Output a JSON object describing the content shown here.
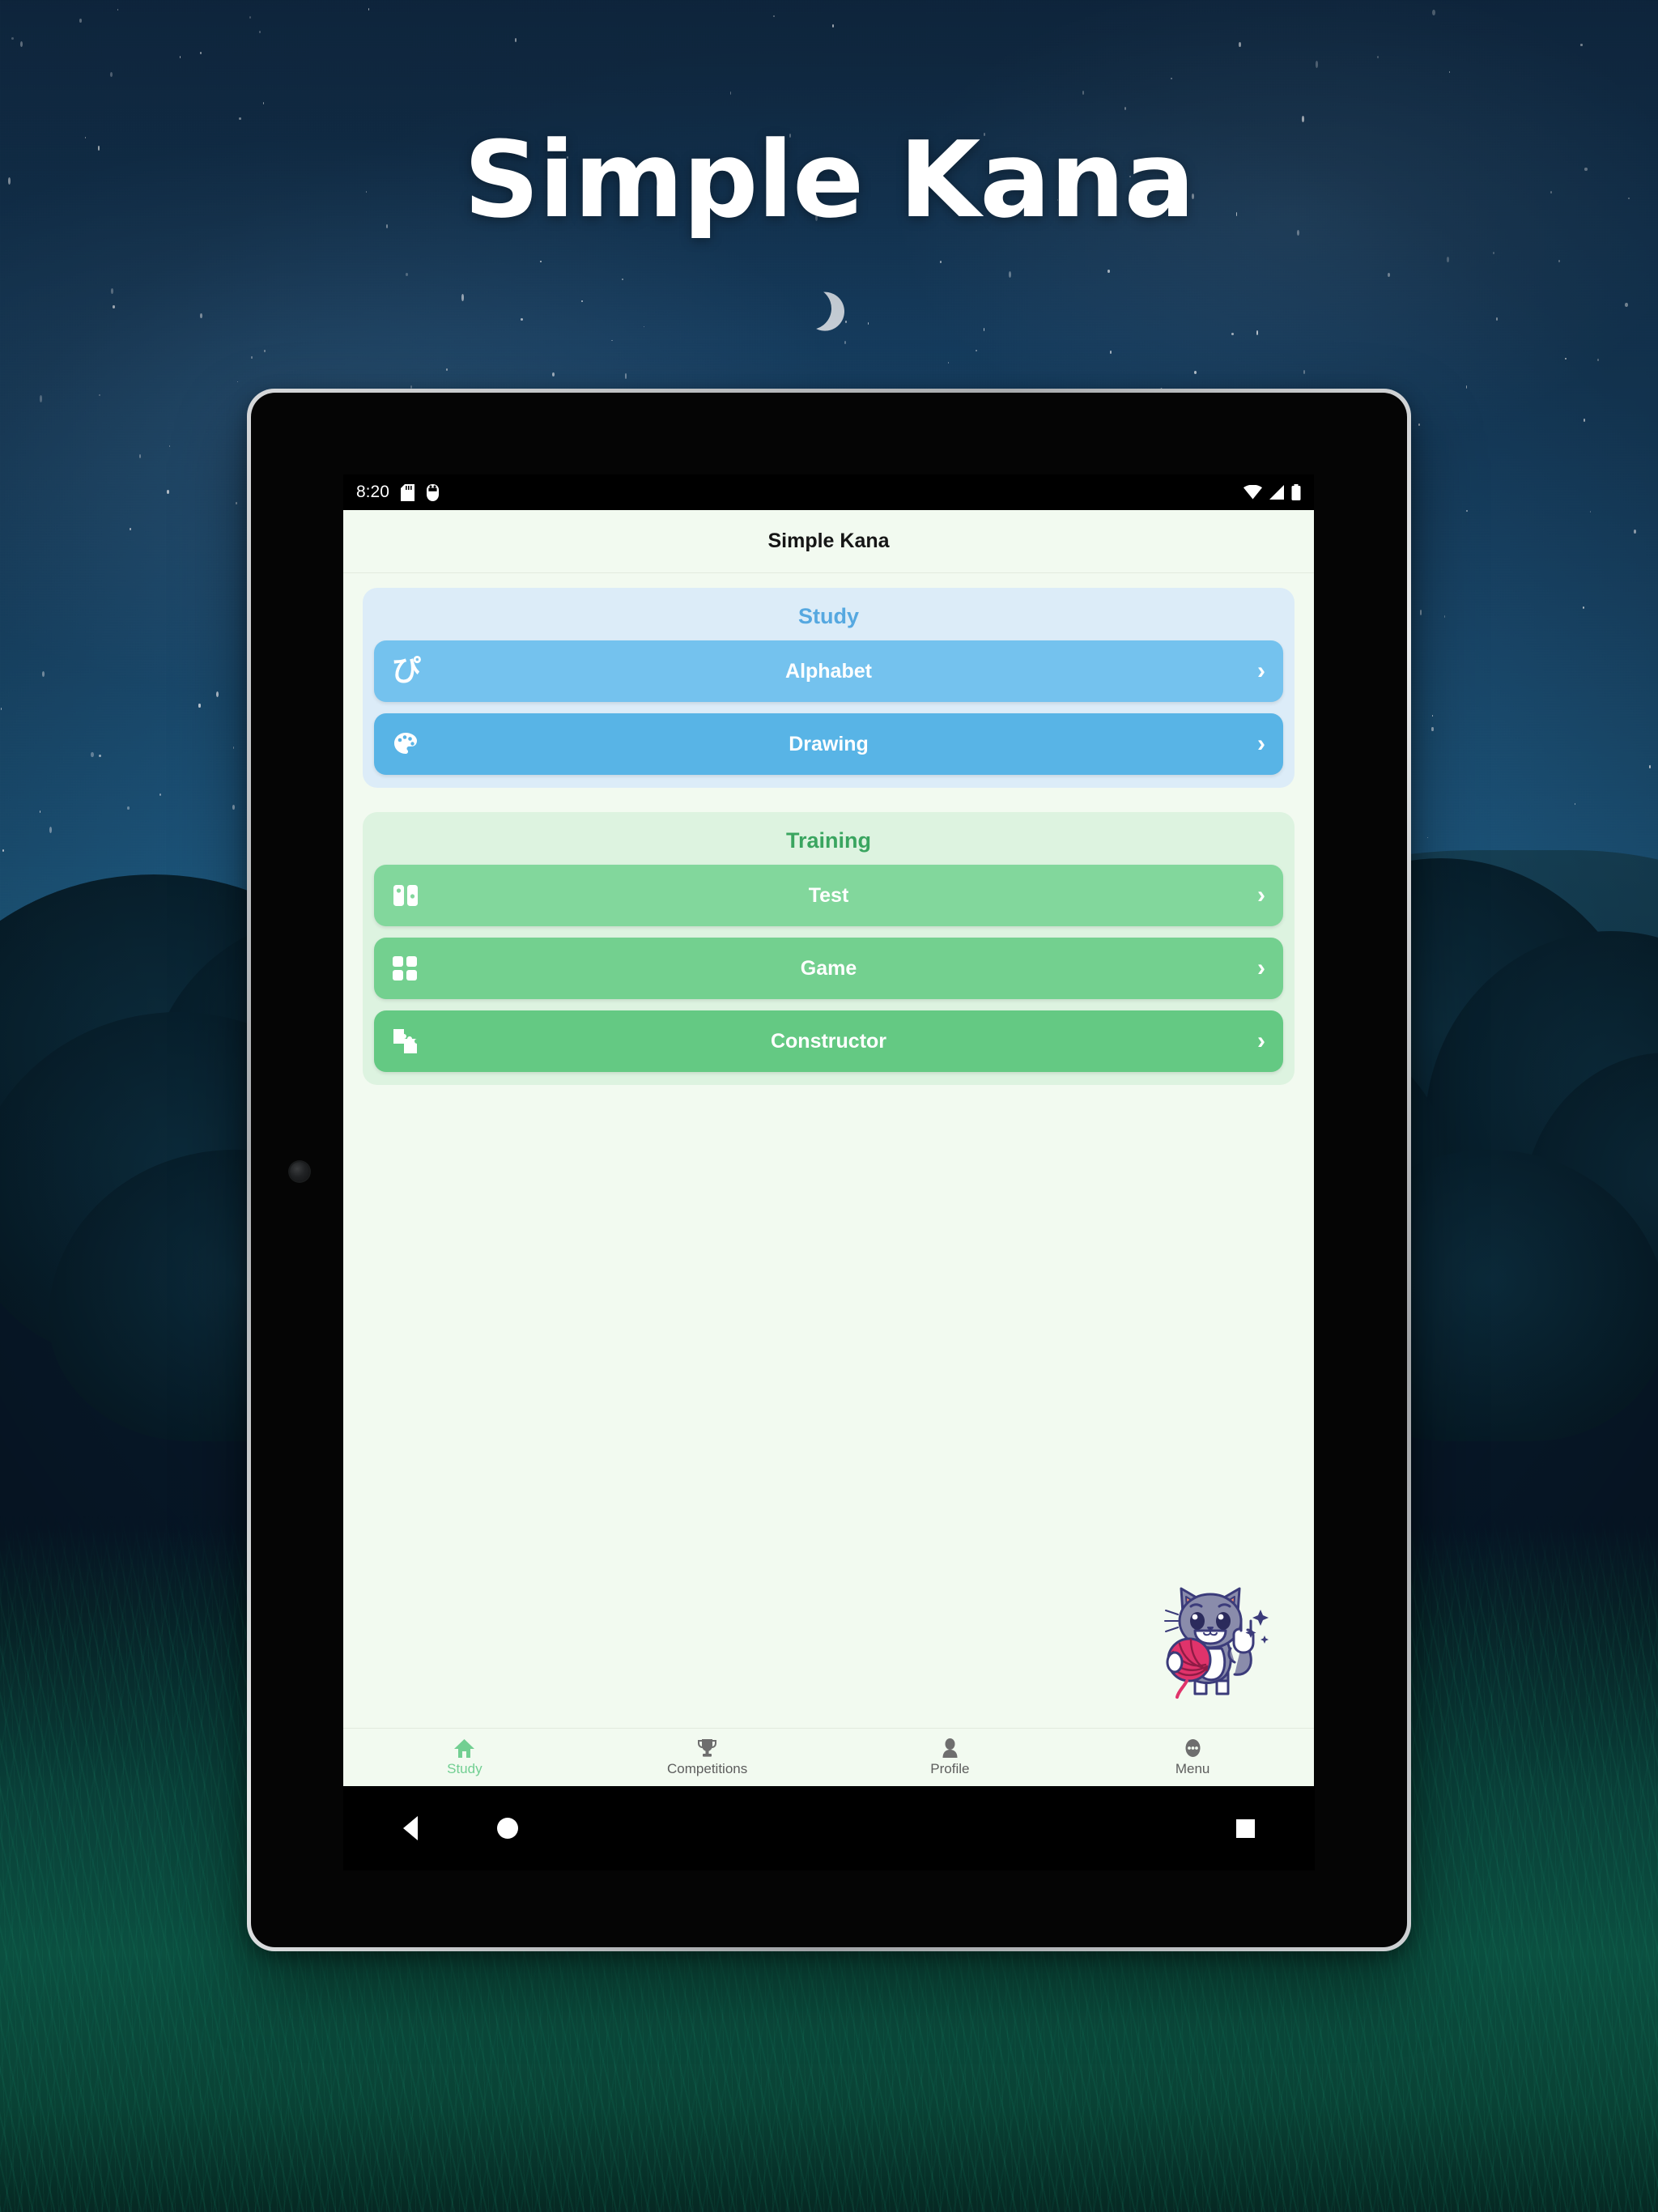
{
  "hero": {
    "title": "Simple Kana"
  },
  "device": {
    "status_bar": {
      "time": "8:20",
      "left_icons": [
        "sd-card-icon",
        "usb-icon"
      ],
      "right_icons": [
        "wifi-icon",
        "cellular-signal-icon",
        "battery-icon"
      ]
    },
    "android_nav": {
      "back": "back-button",
      "home": "home-button",
      "recents": "recents-button"
    }
  },
  "app": {
    "app_bar": {
      "title": "Simple Kana"
    },
    "colors": {
      "screen_background": "#f2faf0",
      "study_section": "#dcecf8",
      "study_title": "#56a8e0",
      "training_section": "#ddf3e0",
      "training_title": "#3aa560",
      "row_alphabet": "#74c2ee",
      "row_drawing": "#58b4e6",
      "row_test": "#82d79c",
      "row_game": "#73d08f",
      "row_constructor": "#64c983",
      "nav_active": "#72cf92",
      "nav_inactive": "#5d5d5d"
    },
    "sections": [
      {
        "key": "study",
        "title": "Study",
        "items": [
          {
            "label": "Alphabet",
            "icon": "kana-pi-icon",
            "glyph": "ぴ",
            "chevron": "›"
          },
          {
            "label": "Drawing",
            "icon": "palette-icon",
            "chevron": "›"
          }
        ]
      },
      {
        "key": "training",
        "title": "Training",
        "items": [
          {
            "label": "Test",
            "icon": "flashcards-icon",
            "chevron": "›"
          },
          {
            "label": "Game",
            "icon": "grid-four-icon",
            "chevron": "›"
          },
          {
            "label": "Constructor",
            "icon": "puzzle-icon",
            "chevron": "›"
          }
        ]
      }
    ],
    "mascot": {
      "name": "cat-with-yarn-mascot"
    },
    "bottom_nav": {
      "items": [
        {
          "label": "Study",
          "icon": "home-icon",
          "active": true
        },
        {
          "label": "Competitions",
          "icon": "trophy-icon",
          "active": false
        },
        {
          "label": "Profile",
          "icon": "person-icon",
          "active": false
        },
        {
          "label": "Menu",
          "icon": "more-dots-icon",
          "active": false
        }
      ]
    }
  }
}
